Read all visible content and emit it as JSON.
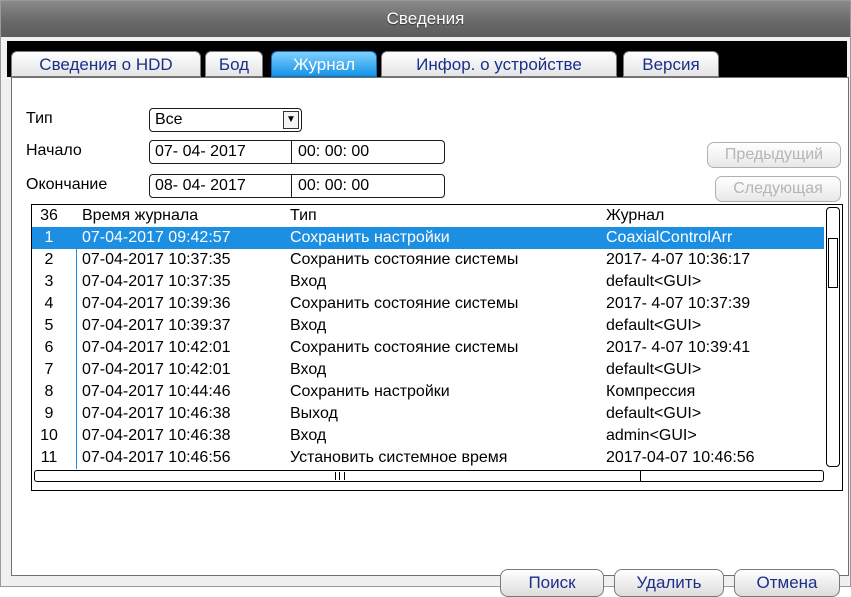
{
  "window": {
    "title": "Сведения"
  },
  "tabs": [
    {
      "label": "Сведения о HDD",
      "active": false
    },
    {
      "label": "Бод",
      "active": false
    },
    {
      "label": "Журнал",
      "active": true
    },
    {
      "label": "Инфор. о устройстве",
      "active": false
    },
    {
      "label": "Версия",
      "active": false
    }
  ],
  "filters": {
    "type_label": "Тип",
    "type_value": "Все",
    "start_label": "Начало",
    "start_date": "07- 04- 2017",
    "start_time": "00: 00: 00",
    "end_label": "Окончание",
    "end_date": "08- 04- 2017",
    "end_time": "00: 00: 00"
  },
  "nav": {
    "prev_label": "Предыдущий",
    "next_label": "Следующая"
  },
  "log": {
    "header": {
      "count": "36",
      "time": "Время журнала",
      "type": "Тип",
      "log": "Журнал"
    },
    "selected_index": 0,
    "rows": [
      {
        "n": "1",
        "time": "07-04-2017 09:42:57",
        "type": "Сохранить настройки",
        "log": "CoaxialControlArr"
      },
      {
        "n": "2",
        "time": "07-04-2017 10:37:35",
        "type": "Сохранить состояние системы",
        "log": "2017- 4-07 10:36:17"
      },
      {
        "n": "3",
        "time": "07-04-2017 10:37:35",
        "type": "Вход",
        "log": "default<GUI>"
      },
      {
        "n": "4",
        "time": "07-04-2017 10:39:36",
        "type": "Сохранить состояние системы",
        "log": "2017- 4-07 10:37:39"
      },
      {
        "n": "5",
        "time": "07-04-2017 10:39:37",
        "type": "Вход",
        "log": "default<GUI>"
      },
      {
        "n": "6",
        "time": "07-04-2017 10:42:01",
        "type": "Сохранить состояние системы",
        "log": "2017- 4-07 10:39:41"
      },
      {
        "n": "7",
        "time": "07-04-2017 10:42:01",
        "type": "Вход",
        "log": "default<GUI>"
      },
      {
        "n": "8",
        "time": "07-04-2017 10:44:46",
        "type": "Сохранить настройки",
        "log": "Компрессия"
      },
      {
        "n": "9",
        "time": "07-04-2017 10:46:38",
        "type": "Выход",
        "log": "default<GUI>"
      },
      {
        "n": "10",
        "time": "07-04-2017 10:46:38",
        "type": "Вход",
        "log": "admin<GUI>"
      },
      {
        "n": "11",
        "time": "07-04-2017 10:46:56",
        "type": "Установить системное время",
        "log": "2017-04-07 10:46:56"
      }
    ]
  },
  "buttons": {
    "search": "Поиск",
    "delete": "Удалить",
    "cancel": "Отмена"
  }
}
